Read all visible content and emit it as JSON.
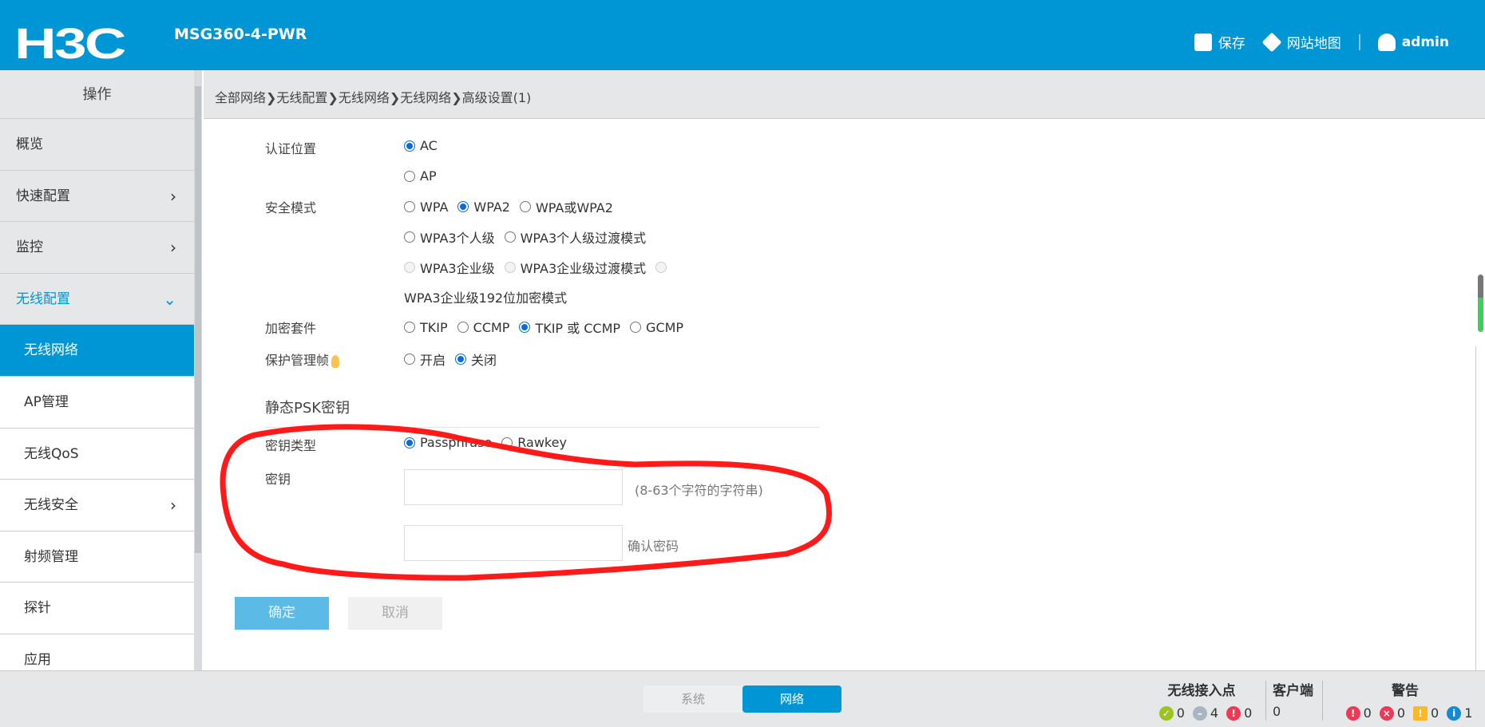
{
  "header": {
    "logo": "H3C",
    "model": "MSG360-4-PWR",
    "save": "保存",
    "sitemap": "网站地图",
    "user": "admin"
  },
  "breadcrumb": "全部网络❯无线配置❯无线网络❯无线网络❯高级设置(1)",
  "sidebar": {
    "title": "操作",
    "items": [
      {
        "label": "概览",
        "chevron": ""
      },
      {
        "label": "快速配置",
        "chevron": "›"
      },
      {
        "label": "监控",
        "chevron": "›"
      },
      {
        "label": "无线配置",
        "chevron": "⌄"
      },
      {
        "label": "无线网络",
        "chevron": ""
      },
      {
        "label": "AP管理",
        "chevron": ""
      },
      {
        "label": "无线QoS",
        "chevron": ""
      },
      {
        "label": "无线安全",
        "chevron": "›"
      },
      {
        "label": "射频管理",
        "chevron": ""
      },
      {
        "label": "探针",
        "chevron": ""
      },
      {
        "label": "应用",
        "chevron": ""
      }
    ]
  },
  "form": {
    "auth_location": {
      "label": "认证位置",
      "options": [
        "AC",
        "AP"
      ],
      "selected": "AC"
    },
    "security_mode": {
      "label": "安全模式",
      "options": [
        "WPA",
        "WPA2",
        "WPA或WPA2",
        "WPA3个人级",
        "WPA3个人级过渡模式",
        "WPA3企业级",
        "WPA3企业级过渡模式",
        "WPA3企业级192位加密模式"
      ],
      "selected": "WPA2"
    },
    "cipher_suite": {
      "label": "加密套件",
      "options": [
        "TKIP",
        "CCMP",
        "TKIP 或 CCMP",
        "GCMP"
      ],
      "selected": "TKIP 或 CCMP"
    },
    "pmf": {
      "label": "保护管理帧",
      "options": [
        "开启",
        "关闭"
      ],
      "selected": "关闭"
    },
    "psk_section": "静态PSK密钥",
    "key_type": {
      "label": "密钥类型",
      "options": [
        "Passphrase",
        "Rawkey"
      ],
      "selected": "Passphrase"
    },
    "key": {
      "label": "密钥",
      "value": "",
      "hint": "(8-63个字符的字符串)",
      "confirm_hint": "确认密码",
      "confirm_value": ""
    },
    "ok": "确定",
    "cancel": "取消"
  },
  "footer": {
    "tabs": [
      "系统",
      "网络"
    ],
    "active_tab": "网络",
    "ap": {
      "title": "无线接入点",
      "online": "0",
      "offline": "4",
      "fault": "0"
    },
    "clients": {
      "title": "客户端",
      "count": "0"
    },
    "alarms": {
      "title": "警告",
      "critical": "0",
      "error": "0",
      "warning": "0",
      "info": "1"
    }
  },
  "colors": {
    "brand": "#0096d6",
    "annotation": "#ff1a1a"
  }
}
